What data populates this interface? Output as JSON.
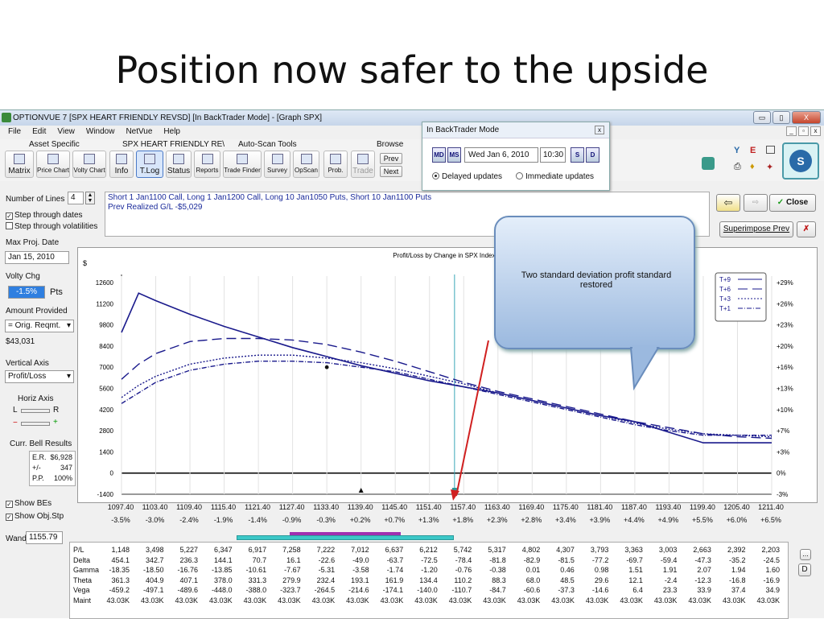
{
  "slide": {
    "title": "Position now safer to the upside"
  },
  "window": {
    "title": "OPTIONVUE 7  [SPX HEART FRIENDLY REVSD]  [In BackTrader Mode] - [Graph SPX]",
    "min_btn": "▭",
    "max_btn": "▯",
    "close_btn": "X"
  },
  "menu": {
    "items": [
      "File",
      "Edit",
      "View",
      "Window",
      "NetVue",
      "Help"
    ]
  },
  "toolbar": {
    "groups": {
      "asset_specific": "Asset Specific",
      "position": "SPX HEART FRIENDLY RE\\",
      "autoscan": "Auto-Scan Tools",
      "browse": "Browse"
    },
    "buttons": {
      "matrix": "Matrix",
      "price_chart": "Price Chart",
      "volty_chart": "Volty Chart",
      "info": "Info",
      "tlog": "T.Log",
      "status": "Status",
      "reports": "Reports",
      "trade_finder": "Trade Finder",
      "survey": "Survey",
      "opscan": "OpScan",
      "prob": "Prob.",
      "trade": "Trade",
      "prev": "Prev",
      "next": "Next"
    }
  },
  "backtrader": {
    "title": "In BackTrader Mode",
    "close": "x",
    "date": "Wed Jan 6, 2010",
    "time": "10:30",
    "delayed": "Delayed updates",
    "immediate": "Immediate updates",
    "nav_dm": "MD",
    "nav_sm": "MS",
    "nav_s": "S",
    "nav_d": "D"
  },
  "position": {
    "line1": "Short 1 Jan1100 Call, Long 1 Jan1200 Call, Long 10 Jan1050 Puts, Short 10 Jan1100 Puts",
    "line2": "Prev Realized G/L -$5,029"
  },
  "right_buttons": {
    "close": "Close",
    "superimpose": "Superimpose Prev"
  },
  "left_panel": {
    "number_of_lines_label": "Number of Lines",
    "number_of_lines": "4",
    "step_dates": "Step through dates",
    "step_vol": "Step through volatilities",
    "max_proj_label": "Max Proj. Date",
    "max_proj": "Jan 15, 2010",
    "volty_label": "Volty Chg",
    "volty_value": "-1.5%",
    "pts": "Pts",
    "amount_label": "Amount Provided",
    "amount_select": "= Orig. Reqmt.",
    "amount_value": "$43,031",
    "vaxis_label": "Vertical Axis",
    "vaxis_select": "Profit/Loss",
    "haxis_label": "Horiz Axis",
    "l": "L",
    "r": "R",
    "minus": "−",
    "plus": "+",
    "bell_label": "Curr. Bell Results",
    "er_label": "E.R.",
    "er_value": "$6,928",
    "pm_label": "+/-",
    "pm_value": "347",
    "pp_label": "P.P.",
    "pp_value": "100%",
    "show_bes": "Show BEs",
    "show_objstp": "Show Obj.Stp",
    "wand_label": "Wand",
    "wand_value": "1155.79"
  },
  "callout": {
    "text": "Two standard deviation profit standard restored"
  },
  "chart_data": {
    "type": "line",
    "title": "Profit/Loss by Change in SPX Index Pr",
    "ylabel": "$",
    "ylim": [
      -1400,
      12600
    ],
    "xlim": [
      1097.4,
      1211.4
    ],
    "y_ticks": [
      "12600",
      "11200",
      "9800",
      "8400",
      "7000",
      "5600",
      "4200",
      "2800",
      "1400",
      "0",
      "-1400"
    ],
    "y_ticks_right": [
      "+29%",
      "+26%",
      "+23%",
      "+20%",
      "+16%",
      "+13%",
      "+10%",
      "+7%",
      "+3%",
      "0%",
      "-3%"
    ],
    "x_ticks": [
      "1097.40",
      "1103.40",
      "1109.40",
      "1115.40",
      "1121.40",
      "1127.40",
      "1133.40",
      "1139.40",
      "1145.40",
      "1151.40",
      "1157.40",
      "1163.40",
      "1169.40",
      "1175.40",
      "1181.40",
      "1187.40",
      "1193.40",
      "1199.40",
      "1205.40",
      "1211.40"
    ],
    "x_ticks_pct": [
      "-3.5%",
      "-3.0%",
      "-2.4%",
      "-1.9%",
      "-1.4%",
      "-0.9%",
      "-0.3%",
      "+0.2%",
      "+0.7%",
      "+1.3%",
      "+1.8%",
      "+2.3%",
      "+2.8%",
      "+3.4%",
      "+3.9%",
      "+4.4%",
      "+4.9%",
      "+5.5%",
      "+6.0%",
      "+6.5%"
    ],
    "current_price": 1155.79,
    "x": [
      1097.4,
      1100.4,
      1103.4,
      1109.4,
      1115.4,
      1121.4,
      1127.4,
      1133.4,
      1139.4,
      1145.4,
      1151.4,
      1157.4,
      1163.4,
      1169.4,
      1175.4,
      1181.4,
      1187.4,
      1193.4,
      1199.4,
      1205.4,
      1211.4
    ],
    "series": [
      {
        "name": "T+9",
        "style": "solid",
        "values": [
          9300,
          11900,
          11400,
          10500,
          9700,
          9000,
          8300,
          7700,
          7100,
          6600,
          6100,
          5700,
          5300,
          4800,
          4300,
          3800,
          3400,
          2700,
          2000,
          2000,
          2000
        ]
      },
      {
        "name": "T+6",
        "style": "dash",
        "values": [
          6200,
          7200,
          7900,
          8700,
          8900,
          8900,
          8800,
          8500,
          8000,
          7400,
          6700,
          6000,
          5400,
          4900,
          4400,
          3900,
          3400,
          3000,
          2600,
          2400,
          2300
        ]
      },
      {
        "name": "T+3",
        "style": "dot",
        "values": [
          5000,
          5800,
          6400,
          7200,
          7600,
          7800,
          7800,
          7600,
          7300,
          6900,
          6400,
          5900,
          5300,
          4800,
          4300,
          3800,
          3300,
          2900,
          2600,
          2500,
          2400
        ]
      },
      {
        "name": "T+1",
        "style": "dashdot",
        "values": [
          4600,
          5300,
          6000,
          6800,
          7200,
          7400,
          7400,
          7300,
          7000,
          6700,
          6200,
          5700,
          5200,
          4700,
          4200,
          3700,
          3200,
          2800,
          2500,
          2500,
          2500
        ]
      }
    ]
  },
  "grid": {
    "rows": [
      {
        "label": "P/L",
        "values": [
          "1,148",
          "3,498",
          "5,227",
          "6,347",
          "6,917",
          "7,258",
          "7,222",
          "7,012",
          "6,637",
          "6,212",
          "5,742",
          "5,317",
          "4,802",
          "4,307",
          "3,793",
          "3,363",
          "3,003",
          "2,663",
          "2,392",
          "2,203"
        ]
      },
      {
        "label": "Delta",
        "values": [
          "454.1",
          "342.7",
          "236.3",
          "144.1",
          "70.7",
          "16.1",
          "-22.6",
          "-49.0",
          "-63.7",
          "-72.5",
          "-78.4",
          "-81.8",
          "-82.9",
          "-81.5",
          "-77.2",
          "-69.7",
          "-59.4",
          "-47.3",
          "-35.2",
          "-24.5"
        ]
      },
      {
        "label": "Gamma",
        "values": [
          "-18.35",
          "-18.50",
          "-16.76",
          "-13.85",
          "-10.61",
          "-7.67",
          "-5.31",
          "-3.58",
          "-1.74",
          "-1.20",
          "-0.76",
          "-0.38",
          "0.01",
          "0.46",
          "0.98",
          "1.51",
          "1.91",
          "2.07",
          "1.94",
          "1.60"
        ]
      },
      {
        "label": "Theta",
        "values": [
          "361.3",
          "404.9",
          "407.1",
          "378.0",
          "331.3",
          "279.9",
          "232.4",
          "193.1",
          "161.9",
          "134.4",
          "110.2",
          "88.3",
          "68.0",
          "48.5",
          "29.6",
          "12.1",
          "-2.4",
          "-12.3",
          "-16.8",
          "-16.9"
        ]
      },
      {
        "label": "Vega",
        "values": [
          "-459.2",
          "-497.1",
          "-489.6",
          "-448.0",
          "-388.0",
          "-323.7",
          "-264.5",
          "-214.6",
          "-174.1",
          "-140.0",
          "-110.7",
          "-84.7",
          "-60.6",
          "-37.3",
          "-14.6",
          "6.4",
          "23.3",
          "33.9",
          "37.4",
          "34.9"
        ]
      },
      {
        "label": "Maint",
        "values": [
          "43.03K",
          "43.03K",
          "43.03K",
          "43.03K",
          "43.03K",
          "43.03K",
          "43.03K",
          "43.03K",
          "43.03K",
          "43.03K",
          "43.03K",
          "43.03K",
          "43.03K",
          "43.03K",
          "43.03K",
          "43.03K",
          "43.03K",
          "43.03K",
          "43.03K",
          "43.03K"
        ]
      }
    ],
    "side_btn_1": "...",
    "side_btn_2": "D"
  },
  "colors": {
    "series_line": "#1a1a8c",
    "arrow": "#d02020",
    "bar_cyan": "#3cc8c8",
    "bar_purple": "#a030b0",
    "volty_bg": "#2f7fe0"
  }
}
